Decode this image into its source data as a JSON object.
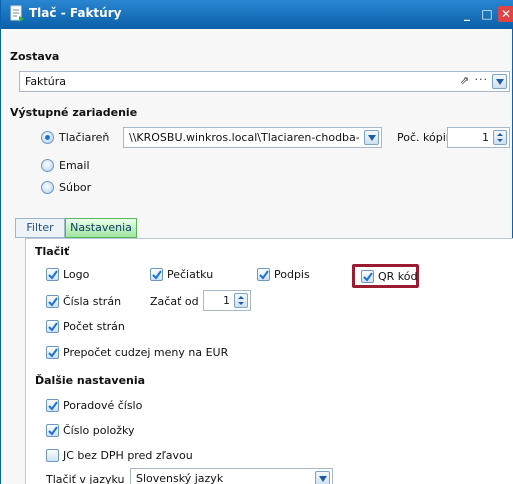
{
  "window": {
    "title": "Tlač - Faktúry"
  },
  "report": {
    "label": "Zostava",
    "value": "Faktúra"
  },
  "output": {
    "label": "Výstupné zariadenie",
    "printer_label": "Tlačiareň",
    "printer_path": "\\\\KROSBU.winkros.local\\Tlaciaren-chodba-farebn",
    "copies_label": "Poč. kópií",
    "copies_value": "1",
    "email_label": "Email",
    "file_label": "Súbor",
    "selected": "printer"
  },
  "tabs": {
    "filter": "Filter",
    "settings": "Nastavenia",
    "active": "settings"
  },
  "print": {
    "label": "Tlačiť",
    "logo": "Logo",
    "stamp": "Pečiatku",
    "signature": "Podpis",
    "qr": "QR kód",
    "page_numbers": "Čísla strán",
    "start_from_label": "Začať od",
    "start_from_value": "1",
    "page_count": "Počet strán",
    "currency": "Prepočet cudzej meny na EUR"
  },
  "more": {
    "label": "Ďalšie nastavenia",
    "seq_number": "Poradové číslo",
    "item_number": "Číslo položky",
    "ic_vat": "JC bez DPH pred zľavou",
    "lang_label": "Tlačiť v jazyku",
    "lang_value": "Slovenský jazyk"
  },
  "colors": {
    "titlebar": "#0a5fa8",
    "highlight": "#9b1b30",
    "active_tab": "#9fe59f",
    "check": "#1a73d9"
  }
}
